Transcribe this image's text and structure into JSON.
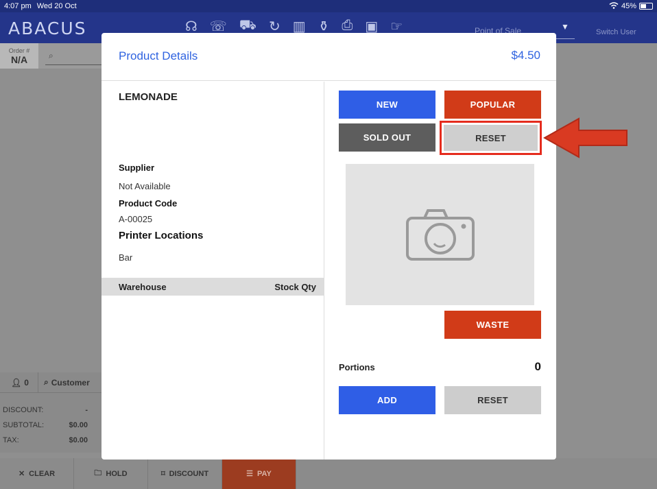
{
  "status_bar": {
    "time": "4:07 pm",
    "date": "Wed 20 Oct",
    "battery": "45%"
  },
  "app": {
    "logo": "ABACUS",
    "mode_selector": "Point of Sale",
    "switch_user": "Switch User",
    "order_label": "Order #",
    "order_value": "N/A",
    "guest_count": "0",
    "customer_label": "Customer"
  },
  "totals": [
    {
      "label": "DISCOUNT:",
      "value": "-"
    },
    {
      "label": "SUBTOTAL:",
      "value": "$0.00"
    },
    {
      "label": "TAX:",
      "value": "$0.00"
    }
  ],
  "bottom_actions": {
    "clear": "CLEAR",
    "hold": "HOLD",
    "discount": "DISCOUNT",
    "pay": "PAY"
  },
  "modal": {
    "title": "Product Details",
    "price": "$4.50",
    "product_name": "LEMONADE",
    "supplier_label": "Supplier",
    "supplier_value": "Not Available",
    "product_code_label": "Product Code",
    "product_code_value": "A-00025",
    "printer_locations_label": "Printer Locations",
    "printer_locations_value": "Bar",
    "warehouse_header": "Warehouse",
    "stock_qty_header": "Stock Qty",
    "buttons": {
      "new": "NEW",
      "popular": "POPULAR",
      "sold_out": "SOLD OUT",
      "reset_status": "RESET",
      "waste": "WASTE",
      "add": "ADD",
      "reset_portions": "RESET"
    },
    "portions_label": "Portions",
    "portions_value": "0"
  },
  "colors": {
    "accent_blue": "#2f5ee6",
    "accent_red": "#d13b18",
    "highlight": "#e52b1d",
    "header_blue": "#24358a"
  },
  "icons": [
    "wifi-icon",
    "battery-icon",
    "headset-icon",
    "phone-icon",
    "cart-icon",
    "refresh-icon",
    "barcode-icon",
    "bottles-icon",
    "printer-icon",
    "drawer-icon",
    "hand-card-icon",
    "search-icon",
    "person-icon",
    "close-icon",
    "folder-icon",
    "tag-icon",
    "cash-icon",
    "camera-icon",
    "arrow-icon"
  ]
}
